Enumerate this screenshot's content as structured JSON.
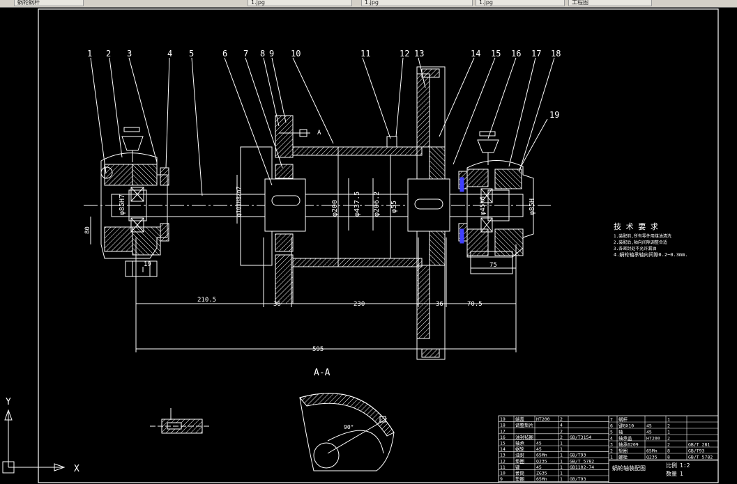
{
  "toolbar": {
    "tabs": [
      "蜗轮蜗杆",
      "1.jpg",
      "1.jpg",
      "1.jpg",
      "1.jpg",
      "工程图"
    ]
  },
  "drawing": {
    "part_labels": [
      "1",
      "2",
      "3",
      "4",
      "5",
      "6",
      "7",
      "8",
      "9",
      "10",
      "11",
      "12",
      "13",
      "14",
      "15",
      "16",
      "17",
      "18",
      "19"
    ],
    "diameters": [
      "φ85H7",
      "φ101H8/n7",
      "φ200",
      "φ437.5",
      "φ206.2",
      "φ55",
      "φ45k6",
      "φ85H"
    ],
    "dimensions": {
      "d_80": "80",
      "d_19": "19",
      "d_75": "75",
      "d_210": "210.5",
      "d_36a": "36",
      "d_230": "230",
      "d_36b": "36",
      "d_70": "70.5",
      "d_595": "595"
    },
    "section_marker": "A",
    "section_title": "A-A",
    "angle_label": "90°",
    "tech_req": {
      "title": "技 术 要 求",
      "lines": [
        "1.装配前,所有零件用煤油清洗",
        "2.装配后,轴向间隙调整合适",
        "3.各密封处不允许漏油",
        "4.蜗轮轴承轴向间隙0.2~0.3mm."
      ]
    },
    "bom": {
      "left_rows": [
        [
          "19",
          "端盖",
          "HT200",
          "2",
          ""
        ],
        [
          "18",
          "调整垫片",
          "",
          "4",
          ""
        ],
        [
          "17",
          "",
          "",
          "2",
          ""
        ],
        [
          "16",
          "油封毡圈",
          "",
          "2",
          "GB/T3154"
        ],
        [
          "15",
          "轴承",
          "45",
          "1",
          ""
        ],
        [
          "14",
          "蜗轮",
          "45",
          "1",
          ""
        ],
        [
          "13",
          "油封",
          "65Mn",
          "1",
          "GB/T93"
        ],
        [
          "12",
          "垫圈",
          "Q235",
          "1",
          "GB/T 5782"
        ],
        [
          "11",
          "键",
          "45",
          "1",
          "GB1102-74"
        ],
        [
          "10",
          "套筒",
          "ZG35",
          "1",
          ""
        ],
        [
          "9",
          "垫圈",
          "65Mn",
          "1",
          "GB/T93"
        ]
      ],
      "right_rows": [
        [
          "7",
          "蜗杆",
          "",
          "1",
          ""
        ],
        [
          "6",
          "键8X10",
          "45",
          "2",
          ""
        ],
        [
          "5",
          "轴",
          "45",
          "1",
          ""
        ],
        [
          "4",
          "轴承盖",
          "HT200",
          "2",
          ""
        ],
        [
          "3",
          "轴承6209",
          "",
          "2",
          "GB/T 281"
        ],
        [
          "2",
          "垫圈",
          "65Mn",
          "8",
          "GB/T93"
        ],
        [
          "1",
          "螺栓",
          "Q235",
          "8",
          "GB/T 5782"
        ]
      ],
      "header": [
        "序号",
        "名 称",
        "材 料",
        "数量",
        "备 注"
      ],
      "title": "蜗轮轴装配图",
      "scale_label": "比例",
      "scale_value": "1:2",
      "qty_label": "数量",
      "qty_value": "1"
    },
    "ucs": {
      "x": "X",
      "y": "Y"
    },
    "colors": {
      "line": "#ffffff",
      "hatch": "#ffffff",
      "blue_part": "#4040ff",
      "background": "#000000"
    }
  }
}
